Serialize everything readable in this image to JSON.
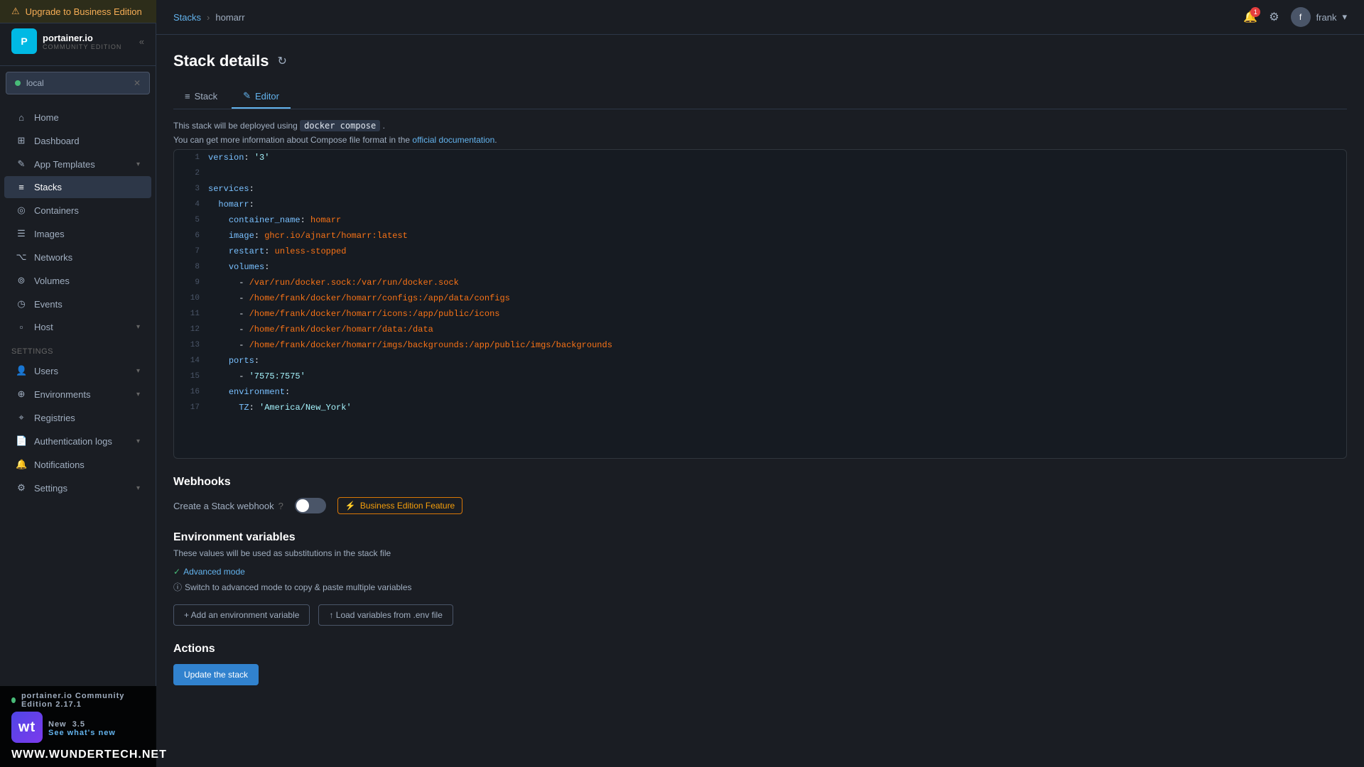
{
  "upgrade_bar": {
    "label": "Upgrade to Business Edition",
    "icon": "warning"
  },
  "sidebar": {
    "logo": {
      "name": "portainer.io",
      "sub": "COMMUNITY EDITION"
    },
    "env": {
      "name": "local",
      "status": "connected"
    },
    "nav_items": [
      {
        "id": "home",
        "label": "Home",
        "icon": "⌂",
        "has_chevron": false,
        "active": false
      },
      {
        "id": "dashboard",
        "label": "Dashboard",
        "icon": "⊞",
        "has_chevron": false,
        "active": false
      },
      {
        "id": "app-templates",
        "label": "App Templates",
        "icon": "✎",
        "has_chevron": true,
        "active": false
      },
      {
        "id": "stacks",
        "label": "Stacks",
        "icon": "≡",
        "has_chevron": false,
        "active": true
      },
      {
        "id": "containers",
        "label": "Containers",
        "icon": "◎",
        "has_chevron": false,
        "active": false
      },
      {
        "id": "images",
        "label": "Images",
        "icon": "☰",
        "has_chevron": false,
        "active": false
      },
      {
        "id": "networks",
        "label": "Networks",
        "icon": "⌥",
        "has_chevron": false,
        "active": false
      },
      {
        "id": "volumes",
        "label": "Volumes",
        "icon": "⊚",
        "has_chevron": false,
        "active": false
      },
      {
        "id": "events",
        "label": "Events",
        "icon": "◷",
        "has_chevron": false,
        "active": false
      },
      {
        "id": "host",
        "label": "Host",
        "icon": "▫",
        "has_chevron": true,
        "active": false
      }
    ],
    "settings_label": "Settings",
    "settings_items": [
      {
        "id": "users",
        "label": "Users",
        "icon": "👤",
        "has_chevron": true,
        "active": false
      },
      {
        "id": "environments",
        "label": "Environments",
        "icon": "⊕",
        "has_chevron": true,
        "active": false
      },
      {
        "id": "registries",
        "label": "Registries",
        "icon": "⌖",
        "has_chevron": false,
        "active": false
      },
      {
        "id": "auth-logs",
        "label": "Authentication logs",
        "icon": "📄",
        "has_chevron": true,
        "active": false
      },
      {
        "id": "notifications",
        "label": "Notifications",
        "icon": "🔔",
        "has_chevron": false,
        "active": false
      },
      {
        "id": "settings",
        "label": "Settings",
        "icon": "⚙",
        "has_chevron": true,
        "active": false
      }
    ]
  },
  "topnav": {
    "breadcrumb_parent": "Stacks",
    "breadcrumb_current": "homarr",
    "user": "frank"
  },
  "page": {
    "title": "Stack details",
    "tabs": [
      {
        "id": "stack",
        "label": "Stack",
        "icon": "≡",
        "active": false
      },
      {
        "id": "editor",
        "label": "Editor",
        "icon": "✎",
        "active": true
      }
    ],
    "info_text_1": "This stack will be deployed using",
    "info_code": "docker compose",
    "info_text_2": ".",
    "info_text_3": "You can get more information about Compose file format in the",
    "info_link": "official documentation",
    "code_lines": [
      {
        "num": 1,
        "content": "version: '3'"
      },
      {
        "num": 2,
        "content": ""
      },
      {
        "num": 3,
        "content": "services:"
      },
      {
        "num": 4,
        "content": "  homarr:"
      },
      {
        "num": 5,
        "content": "    container_name: homarr"
      },
      {
        "num": 6,
        "content": "    image: ghcr.io/ajnart/homarr:latest"
      },
      {
        "num": 7,
        "content": "    restart: unless-stopped"
      },
      {
        "num": 8,
        "content": "    volumes:"
      },
      {
        "num": 9,
        "content": "      - /var/run/docker.sock:/var/run/docker.sock"
      },
      {
        "num": 10,
        "content": "      - /home/frank/docker/homarr/configs:/app/data/configs"
      },
      {
        "num": 11,
        "content": "      - /home/frank/docker/homarr/icons:/app/public/icons"
      },
      {
        "num": 12,
        "content": "      - /home/frank/docker/homarr/data:/data"
      },
      {
        "num": 13,
        "content": "      - /home/frank/docker/homarr/imgs/backgrounds:/app/public/imgs/backgrounds"
      },
      {
        "num": 14,
        "content": "    ports:"
      },
      {
        "num": 15,
        "content": "      - '7575:7575'"
      },
      {
        "num": 16,
        "content": "    environment:"
      },
      {
        "num": 17,
        "content": "      TZ: 'America/New_York'"
      }
    ],
    "webhooks": {
      "title": "Webhooks",
      "label": "Create a Stack webhook",
      "badge": "Business Edition Feature"
    },
    "env_vars": {
      "title": "Environment variables",
      "subtitle": "These values will be used as substitutions in the stack file",
      "mode_label": "Advanced mode",
      "mode_hint": "Switch to advanced mode to copy & paste multiple variables",
      "add_btn": "+ Add an environment variable",
      "load_btn": "↑ Load variables from .env file"
    },
    "actions": {
      "title": "Actions",
      "update_btn": "Update the stack"
    }
  },
  "watermark": {
    "site": "WWW.WUNDERTECH.NET",
    "logo_text": "wt",
    "portainer_label": "portainer.io Community Edition 2.17.1",
    "new_label": "New",
    "version": "3.5",
    "see_whats_new": "See what's new"
  }
}
